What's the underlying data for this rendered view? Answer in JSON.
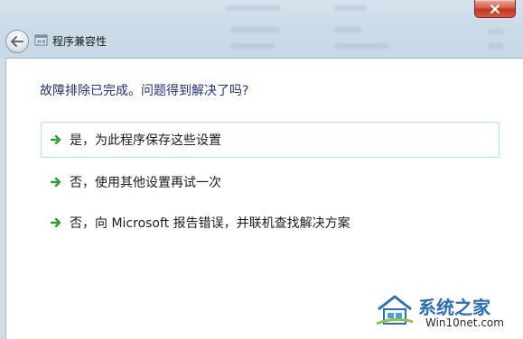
{
  "window": {
    "title": "程序兼容性"
  },
  "icons": {
    "close": "close-icon",
    "back": "back-arrow-icon",
    "app": "compatibility-icon",
    "option_arrow": "green-arrow-icon"
  },
  "colors": {
    "question_text": "#1e3287",
    "arrow_green": "#2ea02e",
    "hover_border": "#aee3ee",
    "close_red": "#c2351f"
  },
  "main": {
    "question": "故障排除已完成。问题得到解决了吗?",
    "options": [
      {
        "label": "是，为此程序保存这些设置",
        "hovered": true
      },
      {
        "label": "否，使用其他设置再试一次",
        "hovered": false
      },
      {
        "label": "否，向 Microsoft 报告错误，并联机查找解决方案",
        "hovered": false
      }
    ]
  },
  "watermark": {
    "brand": "系统之家",
    "site": "Win10net.com"
  }
}
